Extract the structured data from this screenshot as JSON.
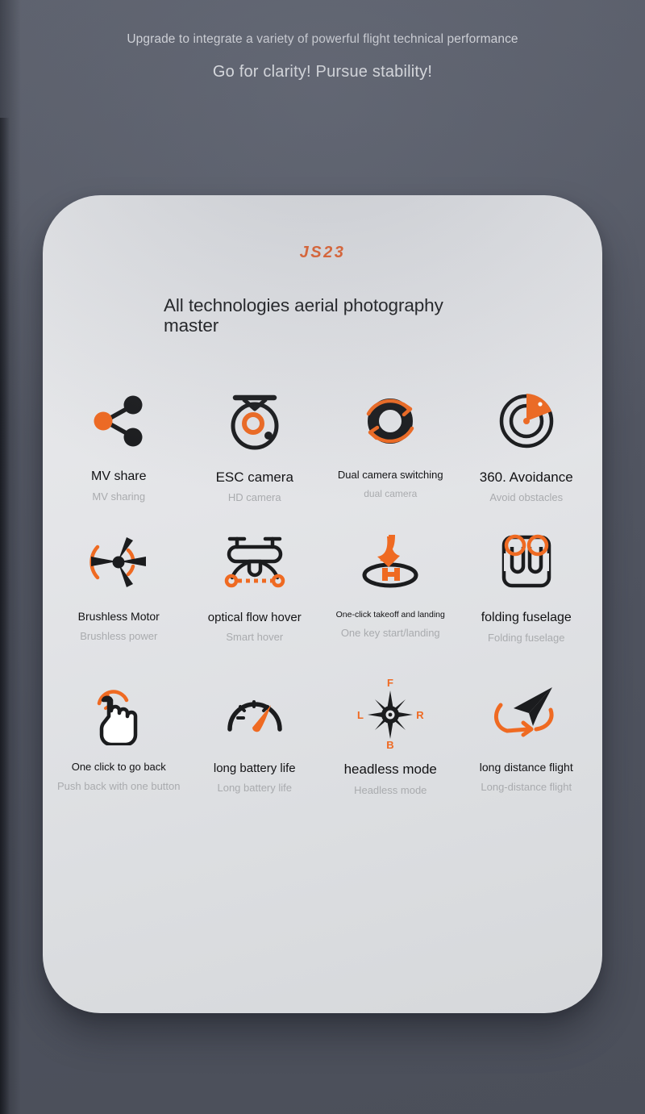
{
  "colors": {
    "accent": "#e8602a",
    "dark": "#1b1c1e",
    "muted": "#a9abae",
    "card_bg": "#e6e7ea",
    "page_bg": "#535764"
  },
  "header": {
    "line1": "Upgrade to integrate a variety of powerful flight technical performance",
    "line2": "Go for clarity! Pursue stability!"
  },
  "card": {
    "brand": "JS23",
    "title": "All technologies aerial photography master"
  },
  "features": [
    {
      "icon": "share-nodes-icon",
      "title": "MV share",
      "subtitle": "MV sharing",
      "title_size": "fs-16",
      "sub_size": "fs-13"
    },
    {
      "icon": "esc-camera-icon",
      "title": "ESC camera",
      "subtitle": "HD camera",
      "title_size": "fs-17",
      "sub_size": "fs-13"
    },
    {
      "icon": "dual-camera-switching-icon",
      "title": "Dual camera switching",
      "subtitle": "dual camera",
      "title_size": "fs-13",
      "sub_size": "fs-12"
    },
    {
      "icon": "radar-avoidance-icon",
      "title": "360. Avoidance",
      "subtitle": "Avoid obstacles",
      "title_size": "fs-17",
      "sub_size": "fs-13"
    },
    {
      "icon": "brushless-motor-icon",
      "title": "Brushless Motor",
      "subtitle": "Brushless power",
      "title_size": "fs-14",
      "sub_size": "fs-13"
    },
    {
      "icon": "optical-flow-hover-icon",
      "title": "optical flow hover",
      "subtitle": "Smart hover",
      "title_size": "fs-15",
      "sub_size": "fs-13"
    },
    {
      "icon": "one-click-takeoff-icon",
      "title": "One-click takeoff and landing",
      "subtitle": "One key start/landing",
      "title_size": "fs-10",
      "sub_size": "fs-13"
    },
    {
      "icon": "folding-fuselage-icon",
      "title": "folding fuselage",
      "subtitle": "Folding fuselage",
      "title_size": "fs-16",
      "sub_size": "fs-13"
    },
    {
      "icon": "one-click-return-icon",
      "title": "One click to go back",
      "subtitle": "Push back with one button",
      "title_size": "fs-13",
      "sub_size": "fs-13"
    },
    {
      "icon": "battery-gauge-icon",
      "title": "long battery life",
      "subtitle": "Long battery life",
      "title_size": "fs-15",
      "sub_size": "fs-13"
    },
    {
      "icon": "headless-mode-compass-icon",
      "title": "headless mode",
      "subtitle": "Headless mode",
      "title_size": "fs-17",
      "sub_size": "fs-13"
    },
    {
      "icon": "long-distance-flight-icon",
      "title": "long distance flight",
      "subtitle": "Long-distance flight",
      "title_size": "fs-14",
      "sub_size": "fs-13"
    }
  ],
  "compass_labels": {
    "front": "F",
    "back": "B",
    "left": "L",
    "right": "R"
  }
}
